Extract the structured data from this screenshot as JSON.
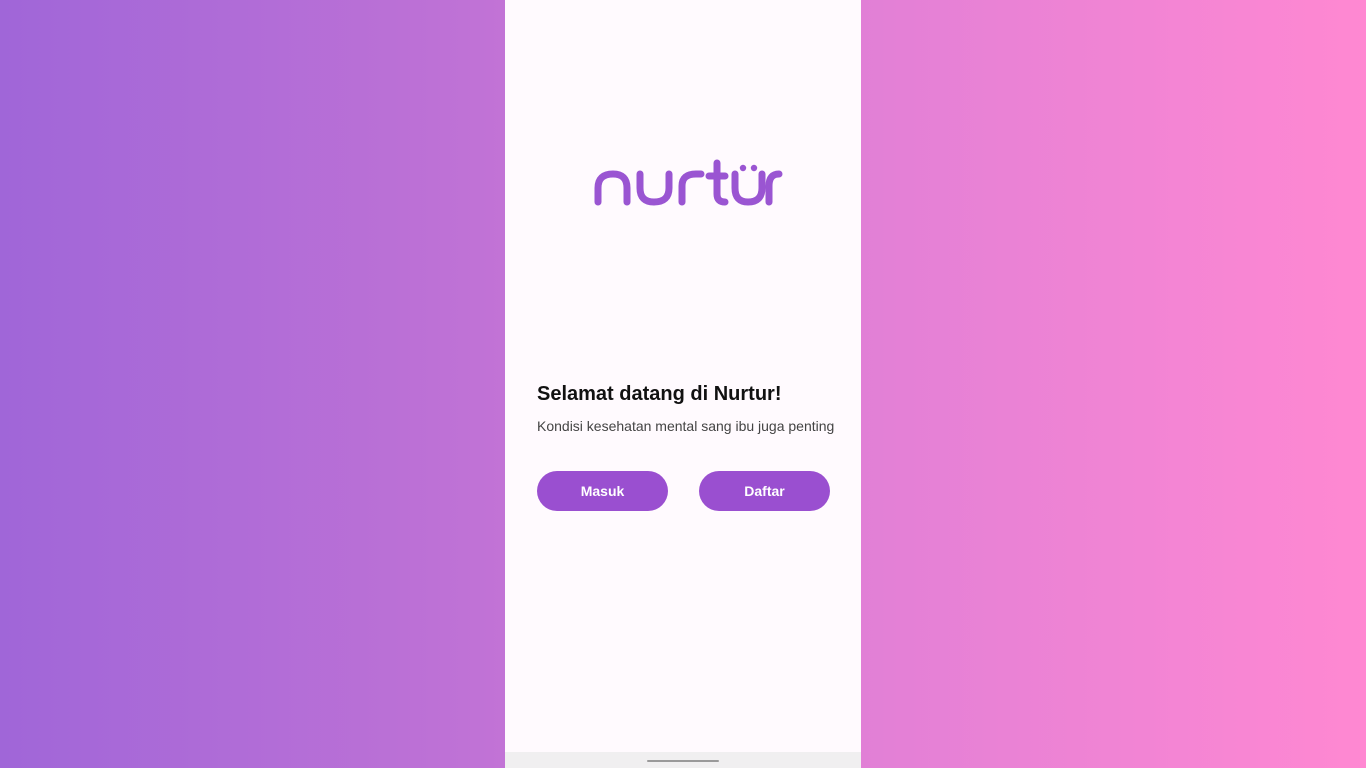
{
  "app": {
    "logo_text": "nurtur",
    "brand_color": "#9a55d2"
  },
  "welcome": {
    "title": "Selamat datang di Nurtur!",
    "subtitle": "Kondisi kesehatan mental sang ibu juga penting"
  },
  "actions": {
    "login_label": "Masuk",
    "register_label": "Daftar"
  },
  "colors": {
    "button": "#9a4fd0",
    "background_left": "#a066d8",
    "background_right": "#ff88d2"
  }
}
